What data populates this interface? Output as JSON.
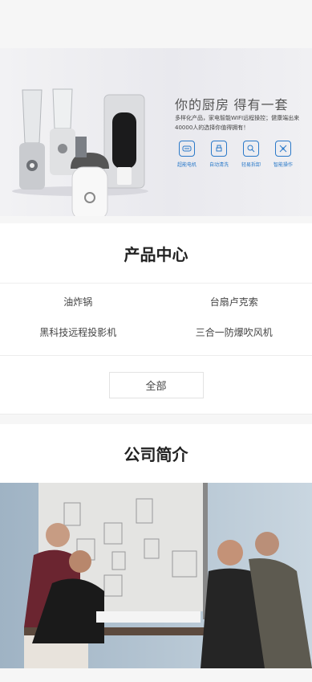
{
  "banner": {
    "title": "你的厨房  得有一套",
    "desc": "多样化产品，家电智能WIFI远程操控；健康端出来40000人的选择你值得拥有！",
    "features": [
      {
        "label": "超能电机",
        "icon": "motor-icon"
      },
      {
        "label": "自动清洗",
        "icon": "cleaning-icon"
      },
      {
        "label": "轻易拆卸",
        "icon": "disassemble-icon"
      },
      {
        "label": "智能操作",
        "icon": "smart-operation-icon"
      }
    ]
  },
  "products": {
    "heading": "产品中心",
    "items": [
      "油炸锅",
      "台扇卢克索",
      "黑科技远程投影机",
      "三合一防爆吹风机"
    ],
    "more_label": "全部"
  },
  "about": {
    "heading": "公司简介"
  },
  "colors": {
    "accent": "#2a79c9",
    "background": "#f6f6f6"
  }
}
